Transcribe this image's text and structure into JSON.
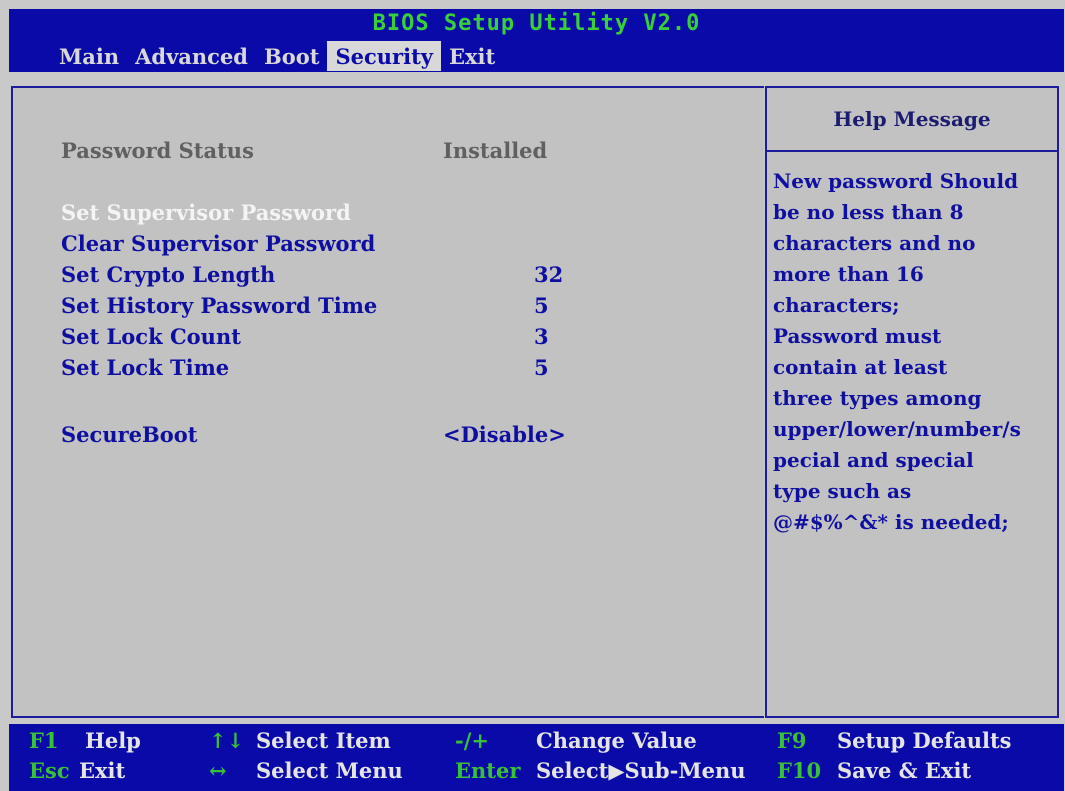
{
  "title": "BIOS Setup Utility V2.0",
  "tabs": [
    {
      "label": "Main"
    },
    {
      "label": "Advanced"
    },
    {
      "label": "Boot"
    },
    {
      "label": "Security"
    },
    {
      "label": "Exit"
    }
  ],
  "active_tab": "Security",
  "settings": {
    "password_status": {
      "label": "Password Status",
      "value": "Installed"
    },
    "set_supervisor": {
      "label": "Set Supervisor Password"
    },
    "clear_supervisor": {
      "label": "Clear Supervisor Password"
    },
    "crypto_length": {
      "label": "Set Crypto Length",
      "value": "32"
    },
    "history_time": {
      "label": "Set History Password Time",
      "value": "5"
    },
    "lock_count": {
      "label": "Set Lock Count",
      "value": "3"
    },
    "lock_time": {
      "label": "Set Lock Time",
      "value": "5"
    },
    "secure_boot": {
      "label": "SecureBoot",
      "value": "<Disable>"
    }
  },
  "help": {
    "title": "Help Message",
    "lines": [
      "New password Should",
      "be no less than 8",
      "characters and no",
      "more than 16",
      "characters;",
      "Password must",
      "contain at least",
      "three types among",
      "upper/lower/number/s",
      "pecial and special",
      "type such as",
      "@#$%^&* is needed;"
    ]
  },
  "footer": {
    "f1": {
      "key": "F1",
      "desc": "Help"
    },
    "updown": {
      "key": "↑↓",
      "desc": "Select Item"
    },
    "minus_plus": {
      "key": "-/+",
      "desc": "Change Value"
    },
    "f9": {
      "key": "F9",
      "desc": "Setup Defaults"
    },
    "esc": {
      "key": "Esc",
      "desc": "Exit"
    },
    "leftright": {
      "key": "↔",
      "desc": "Select Menu"
    },
    "enter": {
      "key": "Enter",
      "desc": "Select▶Sub-Menu"
    },
    "f10": {
      "key": "F10",
      "desc": "Save & Exit"
    }
  },
  "colors": {
    "bar_blue": "#0a0aa8",
    "panel_gray": "#c2c2c2",
    "key_green": "#38c038",
    "item_blue": "#0e0ea0",
    "selected_white": "#f4f4f4"
  }
}
